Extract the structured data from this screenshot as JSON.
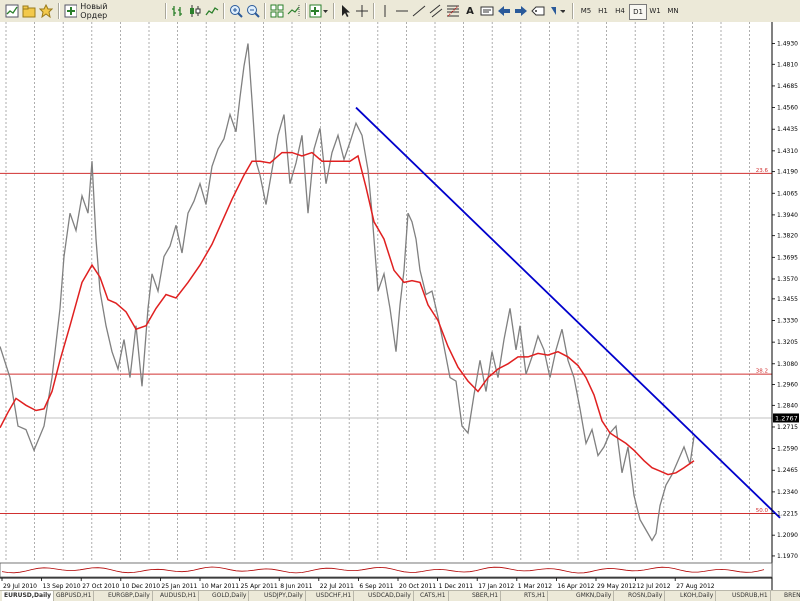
{
  "toolbar": {
    "new_order_label": "Новый Ордер",
    "text_tool_label": "A",
    "timeframes": [
      "M5",
      "H1",
      "H4",
      "D1",
      "W1",
      "MN"
    ],
    "active_timeframe": "D1"
  },
  "chart_data": {
    "type": "line",
    "symbol": "EURUSD,Daily",
    "price_axis_labels": [
      "1.4930",
      "1.4810",
      "1.4685",
      "1.4560",
      "1.4435",
      "1.4310",
      "1.4190",
      "1.4065",
      "1.3940",
      "1.3820",
      "1.3695",
      "1.3570",
      "1.3455",
      "1.3330",
      "1.3205",
      "1.3080",
      "1.2960",
      "1.2840",
      "1.2715",
      "1.2590",
      "1.2465",
      "1.2340",
      "1.2215",
      "1.2090",
      "1.1970"
    ],
    "current_price_label": "1.2767",
    "current_price": 1.2767,
    "ylim": [
      1.1935,
      1.4985
    ],
    "date_labels": [
      "29 Jul 2010",
      "13 Sep 2010",
      "27 Oct 2010",
      "10 Dec 2010",
      "25 Jan 2011",
      "10 Mar 2011",
      "25 Apr 2011",
      "8 Jun 2011",
      "22 Jul 2011",
      "6 Sep 2011",
      "20 Oct 2011",
      "1 Dec 2011",
      "17 Jan 2012",
      "1 Mar 2012",
      "16 Apr 2012",
      "29 May 2012",
      "12 Jul 2012",
      "27 Aug 2012"
    ],
    "price_series": {
      "name": "EURUSD",
      "color": "#808080",
      "x": [
        0,
        10,
        18,
        26,
        34,
        44,
        52,
        60,
        64,
        70,
        76,
        82,
        88,
        92,
        96,
        100,
        106,
        112,
        118,
        124,
        130,
        136,
        142,
        148,
        152,
        158,
        164,
        170,
        176,
        182,
        188,
        194,
        200,
        206,
        212,
        218,
        224,
        230,
        236,
        240,
        244,
        248,
        252,
        256,
        260,
        266,
        272,
        278,
        284,
        290,
        296,
        302,
        308,
        314,
        320,
        326,
        332,
        338,
        344,
        350,
        356,
        362,
        368,
        372,
        378,
        384,
        390,
        396,
        400,
        404,
        408,
        412,
        416,
        420,
        426,
        432,
        438,
        444,
        450,
        456,
        462,
        468,
        474,
        480,
        486,
        492,
        498,
        504,
        510,
        516,
        520,
        526,
        532,
        538,
        544,
        550,
        556,
        562,
        568,
        574,
        580,
        586,
        592,
        598,
        604,
        610,
        616,
        622,
        628,
        634,
        640,
        646,
        652,
        656,
        660,
        666,
        672,
        678,
        684,
        690,
        694
      ],
      "y": [
        1.318,
        1.3,
        1.272,
        1.27,
        1.258,
        1.272,
        1.3,
        1.34,
        1.37,
        1.395,
        1.385,
        1.405,
        1.395,
        1.425,
        1.38,
        1.35,
        1.33,
        1.315,
        1.305,
        1.322,
        1.3,
        1.33,
        1.295,
        1.34,
        1.36,
        1.35,
        1.37,
        1.376,
        1.388,
        1.372,
        1.395,
        1.402,
        1.412,
        1.4,
        1.422,
        1.432,
        1.438,
        1.452,
        1.442,
        1.462,
        1.48,
        1.493,
        1.46,
        1.425,
        1.417,
        1.4,
        1.42,
        1.44,
        1.452,
        1.412,
        1.424,
        1.44,
        1.395,
        1.432,
        1.444,
        1.412,
        1.43,
        1.44,
        1.426,
        1.436,
        1.447,
        1.44,
        1.42,
        1.395,
        1.35,
        1.36,
        1.34,
        1.315,
        1.342,
        1.362,
        1.395,
        1.39,
        1.38,
        1.362,
        1.348,
        1.35,
        1.335,
        1.318,
        1.3,
        1.298,
        1.272,
        1.268,
        1.29,
        1.31,
        1.292,
        1.315,
        1.3,
        1.322,
        1.34,
        1.316,
        1.33,
        1.302,
        1.312,
        1.324,
        1.316,
        1.3,
        1.316,
        1.328,
        1.31,
        1.3,
        1.282,
        1.262,
        1.27,
        1.255,
        1.26,
        1.268,
        1.272,
        1.245,
        1.26,
        1.232,
        1.218,
        1.212,
        1.206,
        1.21,
        1.226,
        1.238,
        1.244,
        1.252,
        1.26,
        1.25,
        1.266
      ]
    },
    "moving_average": {
      "color": "#e02020",
      "x": [
        0,
        8,
        16,
        26,
        36,
        44,
        52,
        60,
        70,
        82,
        92,
        100,
        108,
        116,
        126,
        136,
        146,
        156,
        166,
        176,
        188,
        200,
        212,
        222,
        232,
        244,
        252,
        260,
        270,
        282,
        292,
        302,
        312,
        322,
        332,
        342,
        350,
        358,
        366,
        374,
        384,
        394,
        404,
        412,
        420,
        428,
        438,
        448,
        458,
        468,
        478,
        488,
        498,
        508,
        518,
        528,
        538,
        548,
        558,
        568,
        578,
        586,
        594,
        602,
        610,
        618,
        626,
        634,
        644,
        652,
        660,
        668,
        676,
        684,
        694
      ],
      "y": [
        1.271,
        1.28,
        1.288,
        1.284,
        1.281,
        1.282,
        1.292,
        1.31,
        1.33,
        1.355,
        1.365,
        1.358,
        1.345,
        1.343,
        1.338,
        1.328,
        1.33,
        1.34,
        1.348,
        1.346,
        1.355,
        1.365,
        1.377,
        1.39,
        1.403,
        1.417,
        1.425,
        1.425,
        1.424,
        1.43,
        1.43,
        1.428,
        1.43,
        1.425,
        1.425,
        1.425,
        1.425,
        1.428,
        1.41,
        1.39,
        1.38,
        1.362,
        1.355,
        1.356,
        1.355,
        1.342,
        1.333,
        1.318,
        1.306,
        1.298,
        1.292,
        1.3,
        1.305,
        1.308,
        1.312,
        1.312,
        1.314,
        1.313,
        1.315,
        1.312,
        1.307,
        1.3,
        1.29,
        1.275,
        1.268,
        1.265,
        1.262,
        1.258,
        1.252,
        1.248,
        1.246,
        1.244,
        1.245,
        1.248,
        1.252
      ]
    },
    "trendline": {
      "color": "#0000cc",
      "x": [
        356,
        780
      ],
      "y": [
        1.456,
        1.219
      ]
    },
    "fibonacci_levels": [
      {
        "label": "23.6",
        "price": 1.418
      },
      {
        "label": "38.2",
        "price": 1.302
      },
      {
        "label": "50.0",
        "price": 1.2215
      }
    ],
    "current_price_line": 1.2767,
    "grid": "vertical-dashed"
  },
  "tabs": [
    "EURUSD,Daily",
    "GBPUSD,H1",
    "EURGBP,Daily",
    "AUDUSD,H1",
    "GOLD,Daily",
    "USDJPY,Daily",
    "USDCHF,H1",
    "USDCAD,Daily",
    "CATS,H1",
    "SBER,H1",
    "RTS,H1",
    "GMKN,Daily",
    "ROSN,Daily",
    "LKOH,Daily",
    "USDRUB,H1",
    "BRENT,H1"
  ],
  "active_tab": "EURUSD,Daily"
}
